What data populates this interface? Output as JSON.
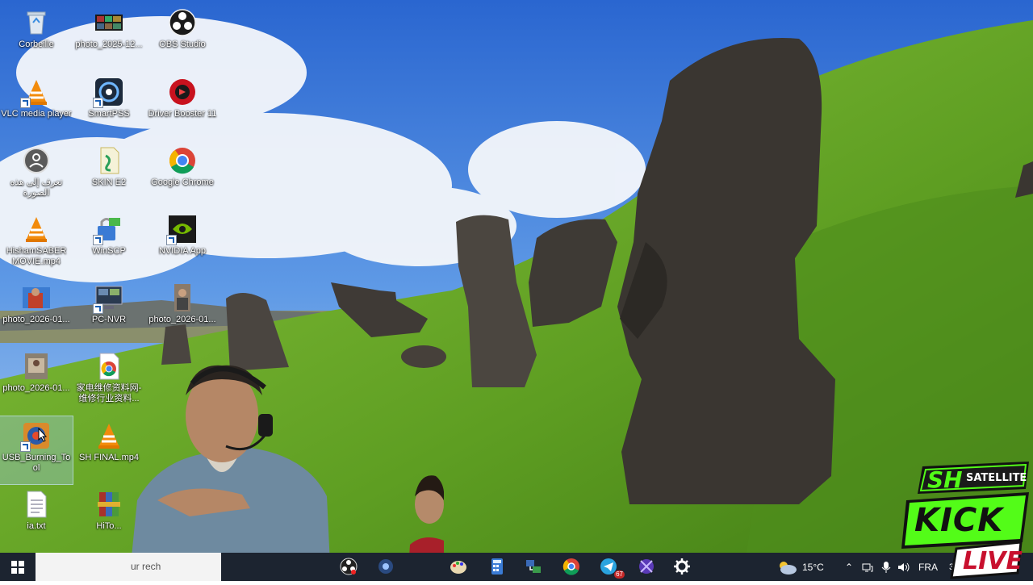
{
  "desktop": {
    "icons": [
      {
        "label": "Corbeille",
        "icon": "recycle-bin-icon"
      },
      {
        "label": "photo_2025-12...",
        "icon": "image-file-icon"
      },
      {
        "label": "OBS Studio",
        "icon": "obs-icon"
      },
      {
        "label": "VLC media player",
        "icon": "vlc-icon"
      },
      {
        "label": "SmartPSS",
        "icon": "smartpss-icon"
      },
      {
        "label": "Driver Booster 11",
        "icon": "driver-booster-icon"
      },
      {
        "label": "تعرف إلى هذه الصورة",
        "icon": "learn-about-picture-icon"
      },
      {
        "label": "SKIN E2",
        "icon": "skin-e2-icon"
      },
      {
        "label": "Google Chrome",
        "icon": "chrome-icon"
      },
      {
        "label": "HishamSABER MOVIE.mp4",
        "icon": "vlc-icon"
      },
      {
        "label": "WinSCP",
        "icon": "winscp-icon"
      },
      {
        "label": "NVIDIA App",
        "icon": "nvidia-icon"
      },
      {
        "label": "photo_2026-01...",
        "icon": "image-file-icon"
      },
      {
        "label": "PC-NVR",
        "icon": "pc-nvr-icon"
      },
      {
        "label": "photo_2026-01...",
        "icon": "image-file-icon"
      },
      {
        "label": "photo_2026-01...",
        "icon": "image-file-icon"
      },
      {
        "label": "家电维修资料网-维修行业资料...",
        "icon": "chrome-html-icon"
      },
      {
        "label": "USB_Burning_Tool",
        "icon": "usb-burning-tool-icon"
      },
      {
        "label": "SH FINAL.mp4",
        "icon": "vlc-icon"
      },
      {
        "label": "ia.txt",
        "icon": "text-file-icon"
      },
      {
        "label": "HiTo...",
        "icon": "winrar-icon"
      }
    ]
  },
  "taskbar": {
    "search_placeholder": "ur rech",
    "weather_temp": "15°C",
    "language": "FRA",
    "telegram_badge": "67",
    "clock_partial": "30"
  },
  "overlay": {
    "brand_top": "SH",
    "brand_sub": "SATELLITE",
    "kick": "KICK",
    "live": "LIVE"
  },
  "colors": {
    "sky_top": "#2f6fd6",
    "grass": "#6fae2a",
    "taskbar": "#1c2430",
    "kick_green": "#53fc18"
  }
}
